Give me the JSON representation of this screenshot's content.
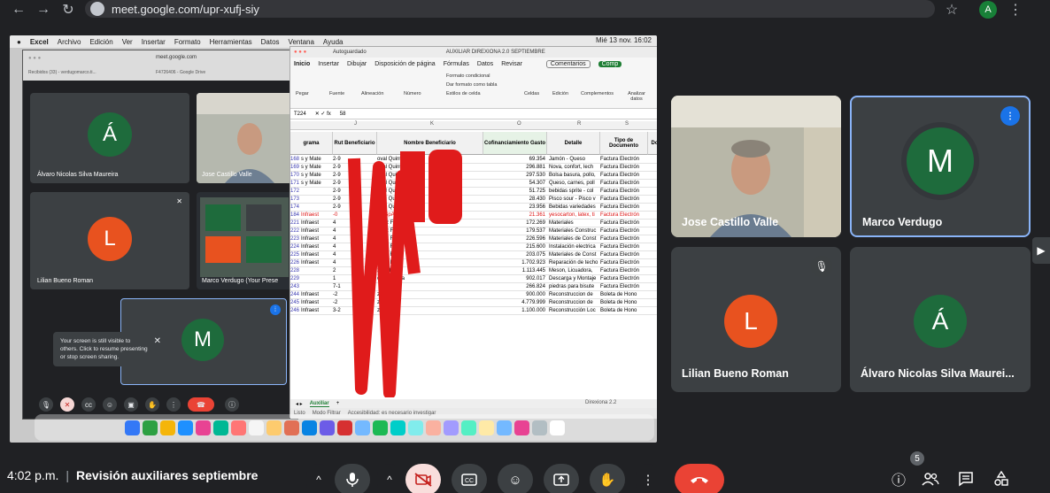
{
  "browser": {
    "url": "meet.google.com/upr-xufj-siy",
    "profile_initial": "A"
  },
  "mac_menubar": {
    "items": [
      "Excel",
      "Archivo",
      "Edición",
      "Ver",
      "Insertar",
      "Formato",
      "Herramientas",
      "Datos",
      "Ventana",
      "Ayuda"
    ],
    "clock": "Mié 13 nov. 16:02"
  },
  "inner_meet": {
    "url": "meet.google.com",
    "tab1": "Recibidos (33) - verdugomarco.ti...",
    "tab2": "F4726406 - Google Drive",
    "participants": [
      {
        "initial": "Á",
        "name": "Álvaro Nicolas Silva Maureira",
        "color": "#1e6b3c"
      },
      {
        "name": "Jose Castillo Valle"
      },
      {
        "initial": "L",
        "name": "Lilian Bueno Roman",
        "color": "#e8521f"
      },
      {
        "name": "Marco Verdugo (Your Prese"
      },
      {
        "initial": "M",
        "name": "",
        "color": "#1e6b3c"
      }
    ],
    "toast": "Your screen is still visible to others. Click to resume presenting or stop screen sharing."
  },
  "excel": {
    "autosave": "Autoguardado",
    "doc_title": "AUXILIAR DIREXIONA 2.0 SEPTIEMBRE",
    "menu": [
      "Inicio",
      "Insertar",
      "Dibujar",
      "Disposición de página",
      "Fórmulas",
      "Datos",
      "Revisar"
    ],
    "comentarios": "Comentarios",
    "compartir": "Comp",
    "ribbon": [
      "Pegar",
      "Fuente",
      "Alineación",
      "Número",
      "Formato condicional",
      "Dar formato como tabla",
      "Estilos de celda",
      "Celdas",
      "Edición",
      "Complementos",
      "Analizar datos"
    ],
    "cell_ref": "T224",
    "formula": "58",
    "col_letters": [
      "J",
      "K",
      "O",
      "R",
      "S"
    ],
    "headers": [
      "grama",
      "Rut Beneficiario",
      "Nombre Beneficiario",
      "Cofinanciamiento Gasto",
      "Detalle",
      "Tipo de Documento",
      "Do"
    ],
    "rows": [
      {
        "n": "168",
        "prog": "s y Mate",
        "rut": "2-9",
        "name": "oval Quintrileo",
        "amt": "69.354",
        "det": "Jamón - Queso",
        "tipo": "Factura Electrón"
      },
      {
        "n": "169",
        "prog": "s y Mate",
        "rut": "2-9",
        "name": "oval Quintrileo",
        "amt": "296.881",
        "det": "Nova, confort, lech",
        "tipo": "Factura Electrón"
      },
      {
        "n": "170",
        "prog": "s y Mate",
        "rut": "2-9",
        "name": "oval Quintrileo",
        "amt": "297.530",
        "det": "Bolsa basura, pollo,",
        "tipo": "Factura Electrón"
      },
      {
        "n": "171",
        "prog": "s y Mate",
        "rut": "2-9",
        "name": "oval Quintrileo",
        "amt": "54.307",
        "det": "Queso, carnes, poll",
        "tipo": "Factura Electrón"
      },
      {
        "n": "172",
        "prog": "",
        "rut": "2-9",
        "name": "oval Quintrileo",
        "amt": "51.725",
        "det": "bebidas sprite - col",
        "tipo": "Factura Electrón"
      },
      {
        "n": "173",
        "prog": "",
        "rut": "2-9",
        "name": "oval Quintrileo",
        "amt": "28.430",
        "det": "Pisco sour - Pisco v",
        "tipo": "Factura Electrón"
      },
      {
        "n": "174",
        "prog": "",
        "rut": "2-9",
        "name": "oval Quintrileo",
        "amt": "23.956",
        "det": "Bebidas variedades",
        "tipo": "Factura Electrón"
      },
      {
        "n": "184",
        "prog": "Infraest",
        "rut": "-0",
        "name": "ña SpA",
        "amt": "21.361",
        "det": "yesocarton, latex, ti",
        "tipo": "Factura Electrón",
        "red": true
      },
      {
        "n": "221",
        "prog": "Infraest",
        "rut": "4",
        "name": "guez Fica",
        "amt": "172.269",
        "det": "Materiales",
        "tipo": "Factura Electrón"
      },
      {
        "n": "222",
        "prog": "Infraest",
        "rut": "4",
        "name": "guez Fica",
        "amt": "179.537",
        "det": "Materiales Construc",
        "tipo": "Factura Electrón"
      },
      {
        "n": "223",
        "prog": "Infraest",
        "rut": "4",
        "name": "guez Fica",
        "amt": "226.596",
        "det": "Materiales de Const",
        "tipo": "Factura Electrón"
      },
      {
        "n": "224",
        "prog": "Infraest",
        "rut": "4",
        "name": "guez Fica",
        "amt": "215.600",
        "det": "Instalación electrica",
        "tipo": "Factura Electrón"
      },
      {
        "n": "225",
        "prog": "Infraest",
        "rut": "4",
        "name": "guez Fica",
        "amt": "203.075",
        "det": "Materiales de Const",
        "tipo": "Factura Electrón"
      },
      {
        "n": "226",
        "prog": "Infraest",
        "rut": "4",
        "name": "guez Fica",
        "amt": "1.702.923",
        "det": "Reparación de techo",
        "tipo": "Factura Electrón"
      },
      {
        "n": "228",
        "prog": "",
        "rut": "2",
        "name": "z Padilla",
        "amt": "1.113.445",
        "det": "Meson, Licuadora,",
        "tipo": "Factura Electrón"
      },
      {
        "n": "229",
        "prog": "",
        "rut": "1",
        "name": "cinos Araya",
        "amt": "902.017",
        "det": "Descarga y Montaje",
        "tipo": "Factura Electrón"
      },
      {
        "n": "243",
        "prog": "",
        "rut": "7-1",
        "name": "",
        "amt": "266.824",
        "det": "piedras para bisute",
        "tipo": "Factura Electrón"
      },
      {
        "n": "244",
        "prog": "Infraest",
        "rut": "-2",
        "name": "zález",
        "amt": "900.000",
        "det": "Reconstruccion de",
        "tipo": "Boleta de Hono"
      },
      {
        "n": "245",
        "prog": "Infraest",
        "rut": "-2",
        "name": "zález",
        "amt": "4.779.999",
        "det": "Reconstruccion de",
        "tipo": "Boleta de Hono"
      },
      {
        "n": "246",
        "prog": "Infraest",
        "rut": "3-2",
        "name": "zález",
        "amt": "1.100.000",
        "det": "Reconstrucción Loc",
        "tipo": "Boleta de Hono"
      }
    ],
    "sheet_tab": "Auxiliar",
    "status_left": "Listo",
    "status_mode": "Modo Filtrar",
    "accessibility": "Accesibilidad: es necesario investigar",
    "file_label": "Direxiona 2.2"
  },
  "tiles": [
    {
      "name": "Jose Castillo Valle"
    },
    {
      "initial": "M",
      "name": "Marco Verdugo",
      "color": "#1e6b3c"
    },
    {
      "initial": "L",
      "name": "Lilian Bueno Roman",
      "color": "#e8521f"
    },
    {
      "initial": "Á",
      "name": "Álvaro Nicolas Silva Maurei...",
      "color": "#1e6b3c"
    }
  ],
  "bottom": {
    "time": "4:02 p.m.",
    "meeting_title": "Revisión auxiliares septiembre",
    "participant_count": "5"
  }
}
